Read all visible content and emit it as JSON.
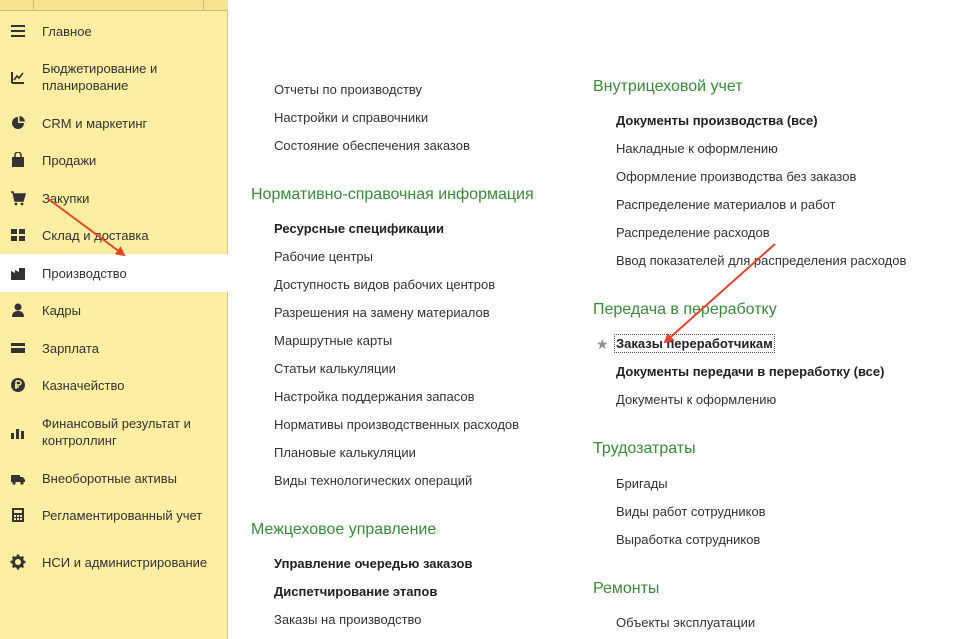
{
  "sidebar": {
    "items": [
      {
        "label": "Главное",
        "icon": "menu-icon"
      },
      {
        "label": "Бюджетирование и планирование",
        "icon": "budget-icon"
      },
      {
        "label": "CRM и маркетинг",
        "icon": "pie-icon"
      },
      {
        "label": "Продажи",
        "icon": "bag-icon"
      },
      {
        "label": "Закупки",
        "icon": "cart-icon"
      },
      {
        "label": "Склад и доставка",
        "icon": "grid-icon"
      },
      {
        "label": "Производство",
        "icon": "factory-icon"
      },
      {
        "label": "Кадры",
        "icon": "person-icon"
      },
      {
        "label": "Зарплата",
        "icon": "card-icon"
      },
      {
        "label": "Казначейство",
        "icon": "ruble-icon"
      },
      {
        "label": "Финансовый результат и контроллинг",
        "icon": "chart-icon"
      },
      {
        "label": "Внеоборотные активы",
        "icon": "truck-icon"
      },
      {
        "label": "Регламентированный учет",
        "icon": "calculator-icon"
      },
      {
        "label": "НСИ и администрирование",
        "icon": "gear-icon"
      }
    ],
    "active_label": "Производство"
  },
  "col1": {
    "top_links": [
      "Отчеты по производству",
      "Настройки и справочники",
      "Состояние обеспечения заказов"
    ],
    "nsi": {
      "title": "Нормативно-справочная информация",
      "links": [
        "Ресурсные спецификации",
        "Рабочие центры",
        "Доступность видов рабочих центров",
        "Разрешения на замену материалов",
        "Маршрутные карты",
        "Статьи калькуляции",
        "Настройка поддержания запасов",
        "Нормативы производственных расходов",
        "Плановые калькуляции",
        "Виды технологических операций"
      ]
    },
    "mezh": {
      "title": "Межцеховое управление",
      "links": [
        "Управление очередью заказов",
        "Диспетчирование этапов",
        "Заказы на производство"
      ]
    }
  },
  "col2": {
    "vnutr": {
      "title": "Внутрицеховой учет",
      "links": [
        "Документы производства (все)",
        "Накладные к оформлению",
        "Оформление производства без заказов",
        "Распределение материалов и работ",
        "Распределение расходов",
        "Ввод показателей для распределения расходов"
      ]
    },
    "pered": {
      "title": "Передача в переработку",
      "links": [
        "Заказы переработчикам",
        "Документы передачи в переработку (все)",
        "Документы к оформлению"
      ]
    },
    "trud": {
      "title": "Трудозатраты",
      "links": [
        "Бригады",
        "Виды работ сотрудников",
        "Выработка сотрудников"
      ]
    },
    "rem": {
      "title": "Ремонты",
      "links": [
        "Объекты эксплуатации"
      ]
    }
  },
  "colors": {
    "sidebar_bg": "#fbeda2",
    "section_title": "#3a8a3a",
    "arrow": "#e8452c"
  }
}
